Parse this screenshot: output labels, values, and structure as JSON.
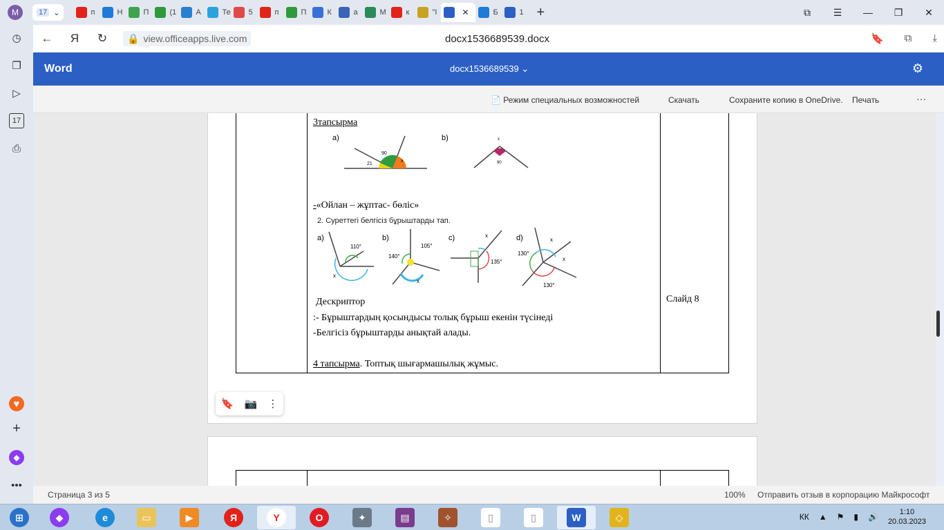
{
  "browser": {
    "profile_initial": "M",
    "tab_group_count": "17",
    "tabs": [
      {
        "icon": "yandex-icon",
        "label": "п"
      },
      {
        "icon": "mail-icon",
        "label": "Н"
      },
      {
        "icon": "sheet-icon",
        "label": "П"
      },
      {
        "icon": "green-one-icon",
        "label": "(1"
      },
      {
        "icon": "butterfly-icon",
        "label": "А"
      },
      {
        "icon": "telegram-icon",
        "label": "Те"
      },
      {
        "icon": "shield-icon",
        "label": "5"
      },
      {
        "icon": "yandex-icon",
        "label": "п"
      },
      {
        "icon": "green-doc-icon",
        "label": "П"
      },
      {
        "icon": "cube-icon",
        "label": "К"
      },
      {
        "icon": "u-icon",
        "label": "a"
      },
      {
        "icon": "book-icon",
        "label": "М"
      },
      {
        "icon": "yandex-icon",
        "label": "к"
      },
      {
        "icon": "globe-icon",
        "label": "\"I"
      },
      {
        "icon": "word-icon",
        "label": "",
        "active": true
      },
      {
        "icon": "v-icon",
        "label": "Б"
      },
      {
        "icon": "word-icon",
        "label": "1"
      }
    ],
    "url": "view.officeapps.live.com",
    "page_title": "docx1536689539.docx"
  },
  "word": {
    "brand": "Word",
    "doc_name": "docx1536689539",
    "toolbar": {
      "accessibility": "Режим специальных возможностей",
      "download": "Скачать",
      "save_copy": "Сохраните копию в OneDrive.",
      "print": "Печать",
      "more": "···"
    }
  },
  "document": {
    "task3": "3тапсырма",
    "fig1_a": "a)",
    "fig1_b": "b)",
    "fig1_90": "90",
    "fig1_21": "21",
    "fig1_x": "x",
    "fig1_b_x": "x",
    "fig1_b_90": "90",
    "think_pair": "«Ойлан – жұптас- бөліс»",
    "think_pair_dash": "-",
    "exercise2": "2.  Суреттегі белгісіз бұрыштарды тап.",
    "fig2": {
      "a": "a)",
      "b": "b)",
      "c": "c)",
      "d": "d)",
      "a_110": "110°",
      "a_x": "x",
      "b_105": "105°",
      "b_140": "140°",
      "b_x": "x",
      "c_x": "x",
      "c_135": "135°",
      "d_130a": "130°",
      "d_x1": "x",
      "d_x2": "x",
      "d_130b": "130°"
    },
    "descriptor": "Дескриптор",
    "desc_line1": ":- Бұрыштардың  қосындысы толық бұрыш екенін  түсінеді",
    "desc_line2": "-Белгісіз  бұрыштарды  анықтай алады.",
    "task4_label": "4  тапсырма",
    "task4_rest": ". Топтық шығармашылық жұмыс.",
    "slide": "Слайд  8"
  },
  "status": {
    "page": "Страница 3 из 5",
    "zoom": "100%",
    "feedback": "Отправить отзыв в корпорацию Майкрософт"
  },
  "taskbar": {
    "lang": "КК",
    "time": "1:10",
    "date": "20.03.2023"
  }
}
